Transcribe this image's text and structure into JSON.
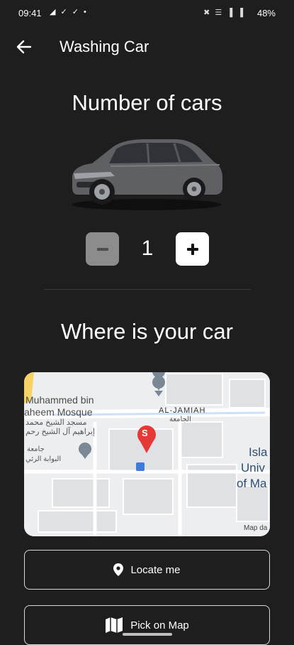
{
  "status_bar": {
    "time": "09:41",
    "left_icons": "◢ ✓ ✓ •",
    "battery_text": "48%",
    "right_icons": "✖ ☰ ▐ ▐"
  },
  "header": {
    "title": "Washing Car",
    "back_icon": "arrow-left-icon"
  },
  "cars": {
    "title": "Number of cars",
    "quantity": "1",
    "minus_label": "−",
    "plus_label": "+"
  },
  "location": {
    "title": "Where is your car"
  },
  "map": {
    "labels": {
      "mosque_line1": "Muhammed bin",
      "mosque_line2": "aheem Mosque",
      "mosque_ar1": "مسجد الشيخ محمد",
      "mosque_ar2": "إبراهيم آل الشيخ رحم",
      "uni_ar1": "جامعة",
      "uni_ar2": "البوابة الرئي",
      "street": "AL-JAMIAH",
      "street_ar": "الجامعة",
      "uni_en1": "Isla",
      "uni_en2": "Univ",
      "uni_en3": "of Ma",
      "attribution": "Map da",
      "pin_letter": "S"
    }
  },
  "buttons": {
    "locate_me": "Locate me",
    "pick_on_map": "Pick on Map"
  },
  "colors": {
    "background": "#1e1e1e",
    "pin": "#e53935",
    "minus_btn": "#8c8c8c",
    "plus_btn": "#ffffff"
  }
}
